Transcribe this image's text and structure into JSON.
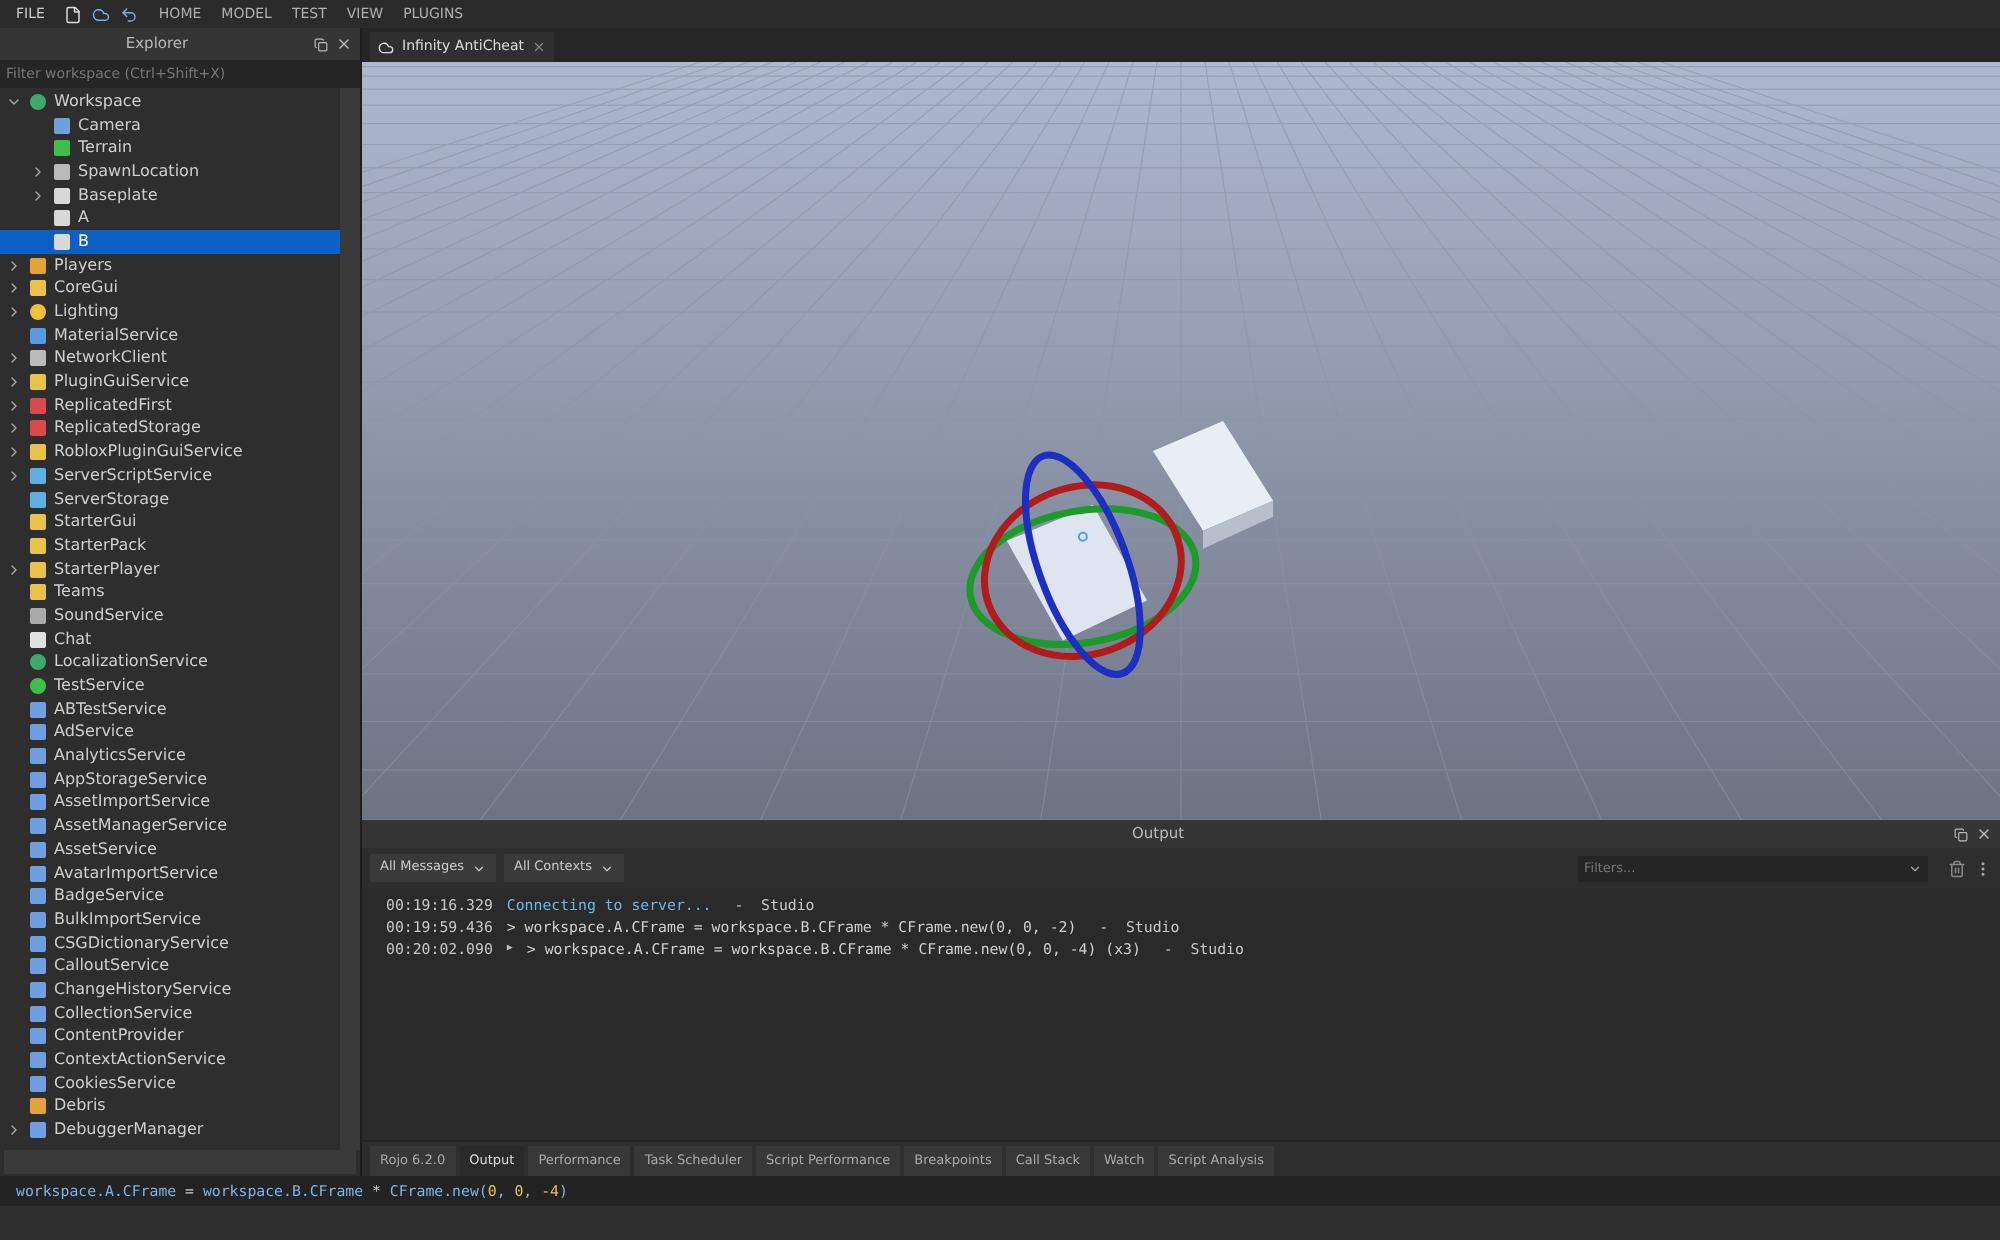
{
  "menu": {
    "file": "FILE",
    "tabs": [
      {
        "label": "HOME",
        "selected": false
      },
      {
        "label": "MODEL",
        "selected": false
      },
      {
        "label": "TEST",
        "selected": false
      },
      {
        "label": "VIEW",
        "selected": false
      },
      {
        "label": "PLUGINS",
        "selected": false
      }
    ]
  },
  "explorer": {
    "title": "Explorer",
    "filter_placeholder": "Filter workspace (Ctrl+Shift+X)",
    "items": [
      {
        "name": "Workspace",
        "kind": "globe",
        "expanded": true,
        "selected": false,
        "children": [
          {
            "name": "Camera",
            "kind": "camera",
            "selected": false
          },
          {
            "name": "Terrain",
            "kind": "terrain",
            "selected": false
          },
          {
            "name": "SpawnLocation",
            "kind": "gear",
            "expanded": false,
            "selected": false
          },
          {
            "name": "Baseplate",
            "kind": "part",
            "expanded": false,
            "selected": false
          },
          {
            "name": "A",
            "kind": "part",
            "selected": false
          },
          {
            "name": "B",
            "kind": "part",
            "selected": true
          }
        ]
      },
      {
        "name": "Players",
        "kind": "people",
        "expanded": false,
        "selected": false
      },
      {
        "name": "CoreGui",
        "kind": "folder",
        "expanded": false,
        "selected": false
      },
      {
        "name": "Lighting",
        "kind": "bulb",
        "expanded": false,
        "selected": false
      },
      {
        "name": "MaterialService",
        "kind": "material",
        "selected": false
      },
      {
        "name": "NetworkClient",
        "kind": "network",
        "expanded": false,
        "selected": false
      },
      {
        "name": "PluginGuiService",
        "kind": "folder",
        "expanded": false,
        "selected": false
      },
      {
        "name": "ReplicatedFirst",
        "kind": "storage",
        "expanded": false,
        "selected": false
      },
      {
        "name": "ReplicatedStorage",
        "kind": "storage",
        "expanded": false,
        "selected": false
      },
      {
        "name": "RobloxPluginGuiService",
        "kind": "folder",
        "expanded": false,
        "selected": false
      },
      {
        "name": "ServerScriptService",
        "kind": "server",
        "expanded": false,
        "selected": false
      },
      {
        "name": "ServerStorage",
        "kind": "server",
        "selected": false
      },
      {
        "name": "StarterGui",
        "kind": "folder",
        "selected": false
      },
      {
        "name": "StarterPack",
        "kind": "folder",
        "selected": false
      },
      {
        "name": "StarterPlayer",
        "kind": "folder",
        "expanded": false,
        "selected": false
      },
      {
        "name": "Teams",
        "kind": "folder",
        "selected": false
      },
      {
        "name": "SoundService",
        "kind": "sound",
        "selected": false
      },
      {
        "name": "Chat",
        "kind": "chat",
        "selected": false
      },
      {
        "name": "LocalizationService",
        "kind": "globe",
        "selected": false
      },
      {
        "name": "TestService",
        "kind": "check",
        "selected": false
      },
      {
        "name": "ABTestService",
        "kind": "service",
        "selected": false
      },
      {
        "name": "AdService",
        "kind": "service",
        "selected": false
      },
      {
        "name": "AnalyticsService",
        "kind": "service",
        "selected": false
      },
      {
        "name": "AppStorageService",
        "kind": "service",
        "selected": false
      },
      {
        "name": "AssetImportService",
        "kind": "service",
        "selected": false
      },
      {
        "name": "AssetManagerService",
        "kind": "service",
        "selected": false
      },
      {
        "name": "AssetService",
        "kind": "service",
        "selected": false
      },
      {
        "name": "AvatarImportService",
        "kind": "service",
        "selected": false
      },
      {
        "name": "BadgeService",
        "kind": "service",
        "selected": false
      },
      {
        "name": "BulkImportService",
        "kind": "service",
        "selected": false
      },
      {
        "name": "CSGDictionaryService",
        "kind": "service",
        "selected": false
      },
      {
        "name": "CalloutService",
        "kind": "service",
        "selected": false
      },
      {
        "name": "ChangeHistoryService",
        "kind": "service",
        "selected": false
      },
      {
        "name": "CollectionService",
        "kind": "service",
        "selected": false
      },
      {
        "name": "ContentProvider",
        "kind": "service",
        "selected": false
      },
      {
        "name": "ContextActionService",
        "kind": "service",
        "selected": false
      },
      {
        "name": "CookiesService",
        "kind": "service",
        "selected": false
      },
      {
        "name": "Debris",
        "kind": "people",
        "selected": false
      },
      {
        "name": "DebuggerManager",
        "kind": "service",
        "expanded": false,
        "selected": false
      }
    ]
  },
  "document_tab": {
    "label": "Infinity AntiCheat",
    "selected": true
  },
  "output": {
    "title": "Output",
    "message_filter": "All Messages",
    "context_filter": "All Contexts",
    "filter_placeholder": "Filters...",
    "lines": [
      {
        "time": "00:19:16.329",
        "kind": "info",
        "text": "Connecting to server...",
        "source": " -  Studio"
      },
      {
        "time": "00:19:59.436",
        "kind": "command",
        "text": "> workspace.A.CFrame = workspace.B.CFrame * CFrame.new(0, 0, -2)",
        "source": " -  Studio"
      },
      {
        "time": "00:20:02.090",
        "kind": "command",
        "marker": "▶",
        "text": "> workspace.A.CFrame = workspace.B.CFrame * CFrame.new(0, 0, -4) (x3)",
        "source": " -  Studio"
      }
    ]
  },
  "bottom_tabs": [
    {
      "label": "Rojo 6.2.0",
      "selected": false
    },
    {
      "label": "Output",
      "selected": true
    },
    {
      "label": "Performance",
      "selected": false
    },
    {
      "label": "Task Scheduler",
      "selected": false
    },
    {
      "label": "Script Performance",
      "selected": false
    },
    {
      "label": "Breakpoints",
      "selected": false
    },
    {
      "label": "Call Stack",
      "selected": false
    },
    {
      "label": "Watch",
      "selected": false
    },
    {
      "label": "Script Analysis",
      "selected": false
    }
  ],
  "command_bar": {
    "tokens": [
      {
        "text": "workspace.A.CFrame",
        "kind": "code"
      },
      {
        "text": " = ",
        "kind": "operator"
      },
      {
        "text": "workspace.B.CFrame",
        "kind": "code"
      },
      {
        "text": " * ",
        "kind": "operator"
      },
      {
        "text": "CFrame.new(",
        "kind": "code"
      },
      {
        "text": "0",
        "kind": "number"
      },
      {
        "text": ", ",
        "kind": "code"
      },
      {
        "text": "0",
        "kind": "number"
      },
      {
        "text": ", ",
        "kind": "code"
      },
      {
        "text": "-4",
        "kind": "number"
      },
      {
        "text": ")",
        "kind": "code"
      }
    ]
  }
}
